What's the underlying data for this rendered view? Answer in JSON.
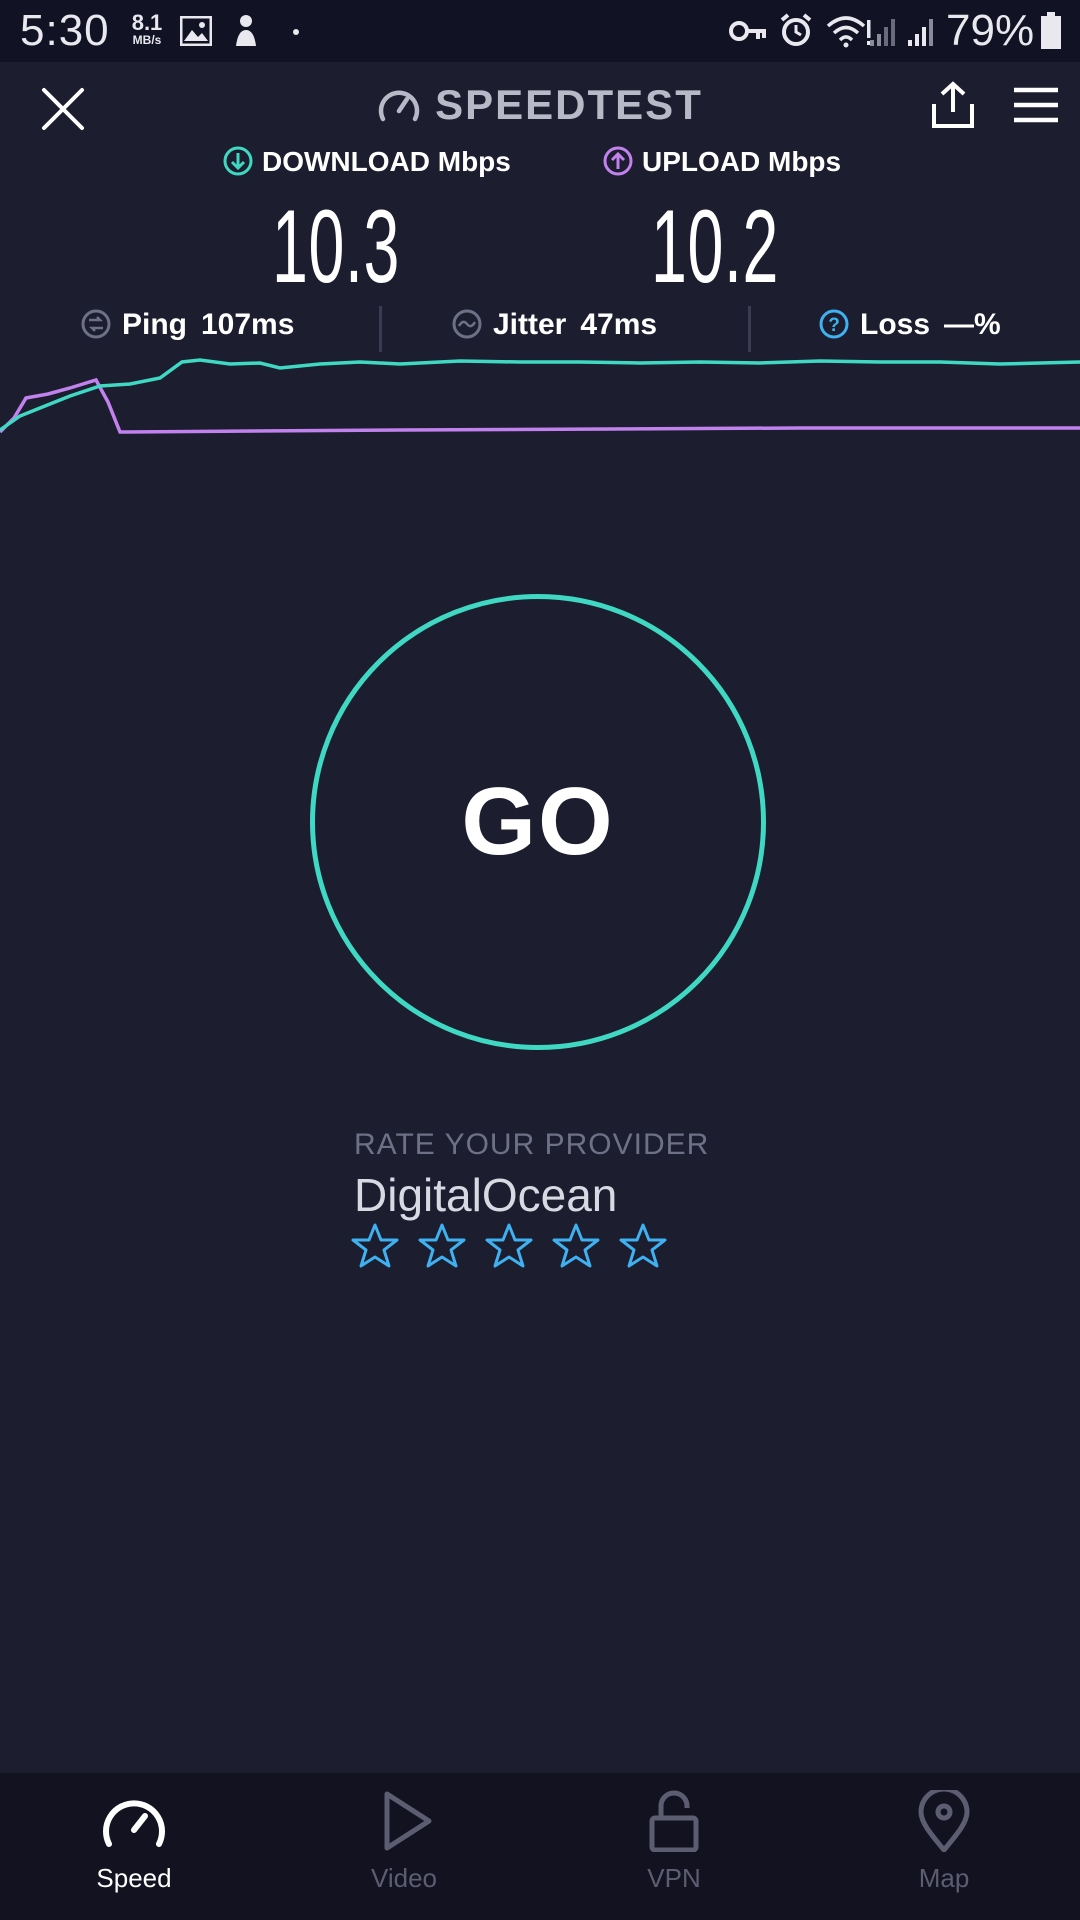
{
  "status_bar": {
    "time": "5:30",
    "net_speed_value": "8.1",
    "net_speed_unit": "MB/s",
    "battery": "79%",
    "icons": [
      "gallery-icon",
      "notification-icon",
      "vpn-key-icon",
      "alarm-icon",
      "wifi-icon",
      "signal-icon",
      "battery-icon"
    ]
  },
  "header": {
    "title": "SPEEDTEST"
  },
  "download": {
    "label": "DOWNLOAD Mbps",
    "value": "10.3"
  },
  "upload": {
    "label": "UPLOAD Mbps",
    "value": "10.2"
  },
  "stats": {
    "ping": {
      "label": "Ping",
      "value": "107ms"
    },
    "jitter": {
      "label": "Jitter",
      "value": "47ms"
    },
    "loss": {
      "label": "Loss",
      "value": "—%"
    }
  },
  "go_button": {
    "label": "GO"
  },
  "rating": {
    "prompt": "RATE YOUR PROVIDER",
    "provider": "DigitalOcean",
    "stars_total": 5,
    "stars_selected": 0
  },
  "nav": {
    "items": [
      {
        "label": "Speed",
        "active": true
      },
      {
        "label": "Video",
        "active": false
      },
      {
        "label": "VPN",
        "active": false
      },
      {
        "label": "Map",
        "active": false
      }
    ]
  },
  "colors": {
    "background": "#1c1d2f",
    "download": "#3fd9c3",
    "upload": "#c282ee",
    "accent_blue": "#3fb1f0",
    "nav_bg": "#121221"
  }
}
